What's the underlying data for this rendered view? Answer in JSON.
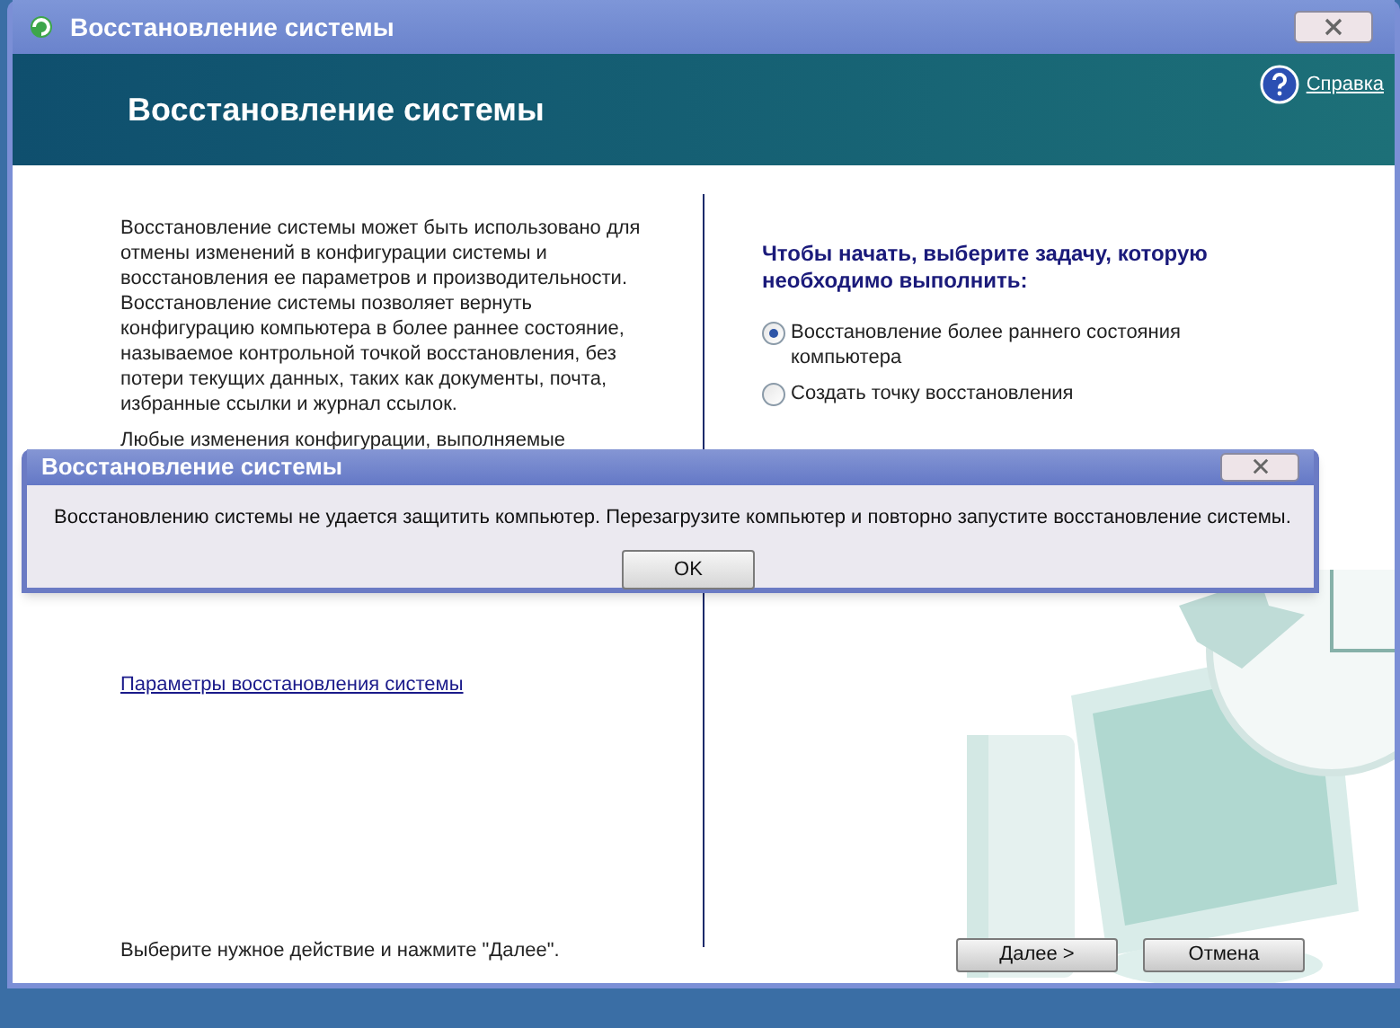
{
  "window": {
    "title": "Восстановление системы"
  },
  "header": {
    "title": "Восстановление системы",
    "help_link": "Справка"
  },
  "left": {
    "paragraphs": [
      "Восстановление системы может быть использовано для отмены изменений в конфигурации системы и восстановления ее параметров и производительности. Восстановление системы позволяет вернуть конфигурацию компьютера в более раннее состояние, называемое контрольной точкой восстановления, без потери текущих данных, таких как документы, почта, избранные ссылки и журнал ссылок.",
      "Любые изменения конфигурации, выполняемые"
    ],
    "settings_link": "Параметры восстановления системы",
    "hint": "Выберите нужное действие и нажмите \"Далее\"."
  },
  "right": {
    "prompt": "Чтобы начать, выберите задачу, которую необходимо выполнить:",
    "options": [
      {
        "label": "Восстановление более раннего состояния компьютера",
        "selected": true
      },
      {
        "label": "Создать точку восстановления",
        "selected": false
      }
    ]
  },
  "buttons": [
    {
      "label": "Далее >"
    },
    {
      "label": "Отмена"
    }
  ],
  "dialog": {
    "title": "Восстановление системы",
    "message": "Восстановлению системы не удается защитить компьютер. Перезагрузите компьютер и повторно запустите восстановление системы.",
    "button": "OK"
  }
}
